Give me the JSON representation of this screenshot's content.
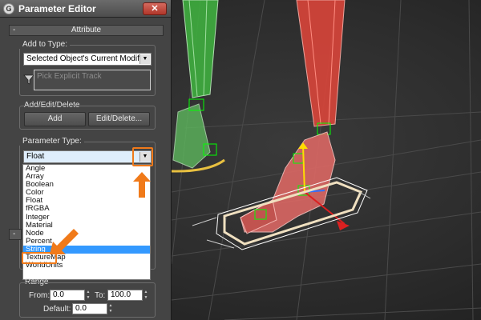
{
  "window": {
    "title": "Parameter Editor",
    "app_icon": "G",
    "close_glyph": "✕"
  },
  "rollout": {
    "title": "Attribute",
    "collapse_glyph": "-"
  },
  "add_to_type": {
    "label": "Add to Type:",
    "selected": "Selected Object's Current Modifier",
    "explicit_track_placeholder": "Pick Explicit Track"
  },
  "add_edit_delete": {
    "label": "Add/Edit/Delete",
    "add_label": "Add",
    "edit_delete_label": "Edit/Delete..."
  },
  "parameter_type": {
    "label": "Parameter Type:",
    "selected": "Float",
    "options": [
      "Angle",
      "Array",
      "Boolean",
      "Color",
      "Float",
      "fRGBA",
      "Integer",
      "Material",
      "Node",
      "Percent",
      "String",
      "TextureMap",
      "WorldUnits"
    ],
    "highlighted_index": 10
  },
  "range": {
    "label": "Range",
    "from_label": "From:",
    "from_value": "0.0",
    "to_label": "To:",
    "to_value": "100.0",
    "default_label": "Default:",
    "default_value": "0.0"
  },
  "colors": {
    "accent_orange": "#f07a1a",
    "selection_blue": "#3399ff",
    "green_bone": "#3fae3f",
    "red_bone": "#e0554c"
  }
}
